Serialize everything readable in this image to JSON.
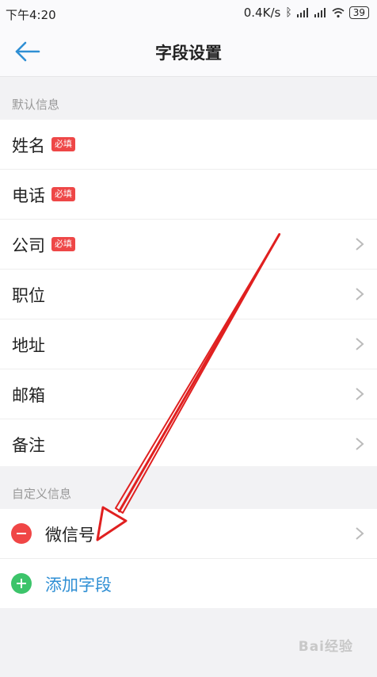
{
  "status": {
    "time": "下午4:20",
    "speed": "0.4K/s",
    "battery": "39"
  },
  "nav": {
    "title": "字段设置"
  },
  "default_section": {
    "header": "默认信息",
    "required_label": "必填",
    "items": [
      {
        "label": "姓名"
      },
      {
        "label": "电话"
      },
      {
        "label": "公司"
      },
      {
        "label": "职位"
      },
      {
        "label": "地址"
      },
      {
        "label": "邮箱"
      },
      {
        "label": "备注"
      }
    ]
  },
  "custom_section": {
    "header": "自定义信息",
    "items": [
      {
        "label": "微信号"
      }
    ],
    "add_label": "添加字段"
  },
  "watermark": "Bai经验",
  "colors": {
    "accent": "#2f8fd4",
    "required": "#ee4747",
    "delete": "#f04646",
    "add": "#3cc46a",
    "annotation_arrow": "#e02020"
  }
}
